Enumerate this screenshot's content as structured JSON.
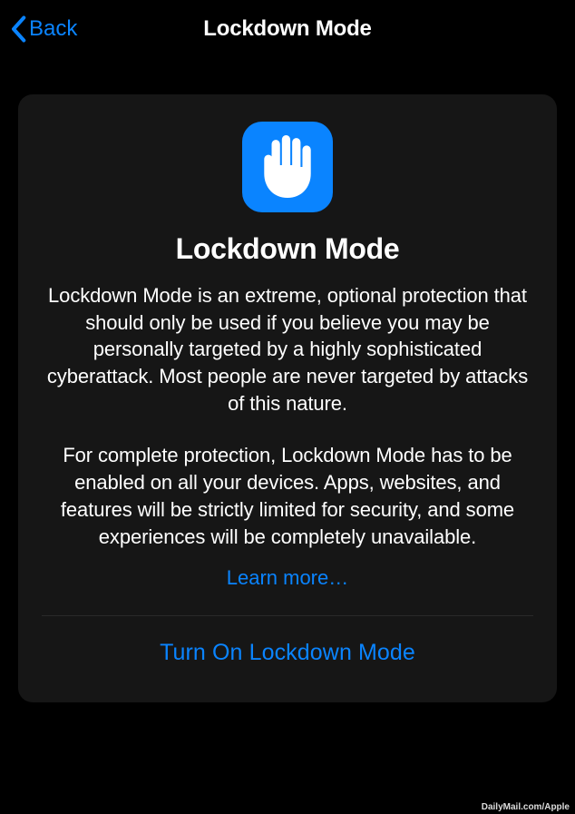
{
  "nav": {
    "back_label": "Back",
    "title": "Lockdown Mode"
  },
  "content": {
    "title": "Lockdown Mode",
    "paragraph1": "Lockdown Mode is an extreme, optional protection that should only be used if you believe you may be personally targeted by a highly sophisticated cyberattack. Most people are never targeted by attacks of this nature.",
    "paragraph2": "For complete protection, Lockdown Mode has to be enabled on all your devices. Apps, websites, and features will be strictly limited for security, and some experiences will be completely unavailable.",
    "learn_more_label": "Learn more…"
  },
  "action": {
    "turn_on_label": "Turn On Lockdown Mode"
  },
  "attribution": "DailyMail.com/Apple",
  "colors": {
    "accent": "#0a84ff",
    "background": "#000",
    "card": "#161616"
  },
  "icons": {
    "hand": "hand-raised-icon",
    "chevron_left": "chevron-left-icon"
  }
}
